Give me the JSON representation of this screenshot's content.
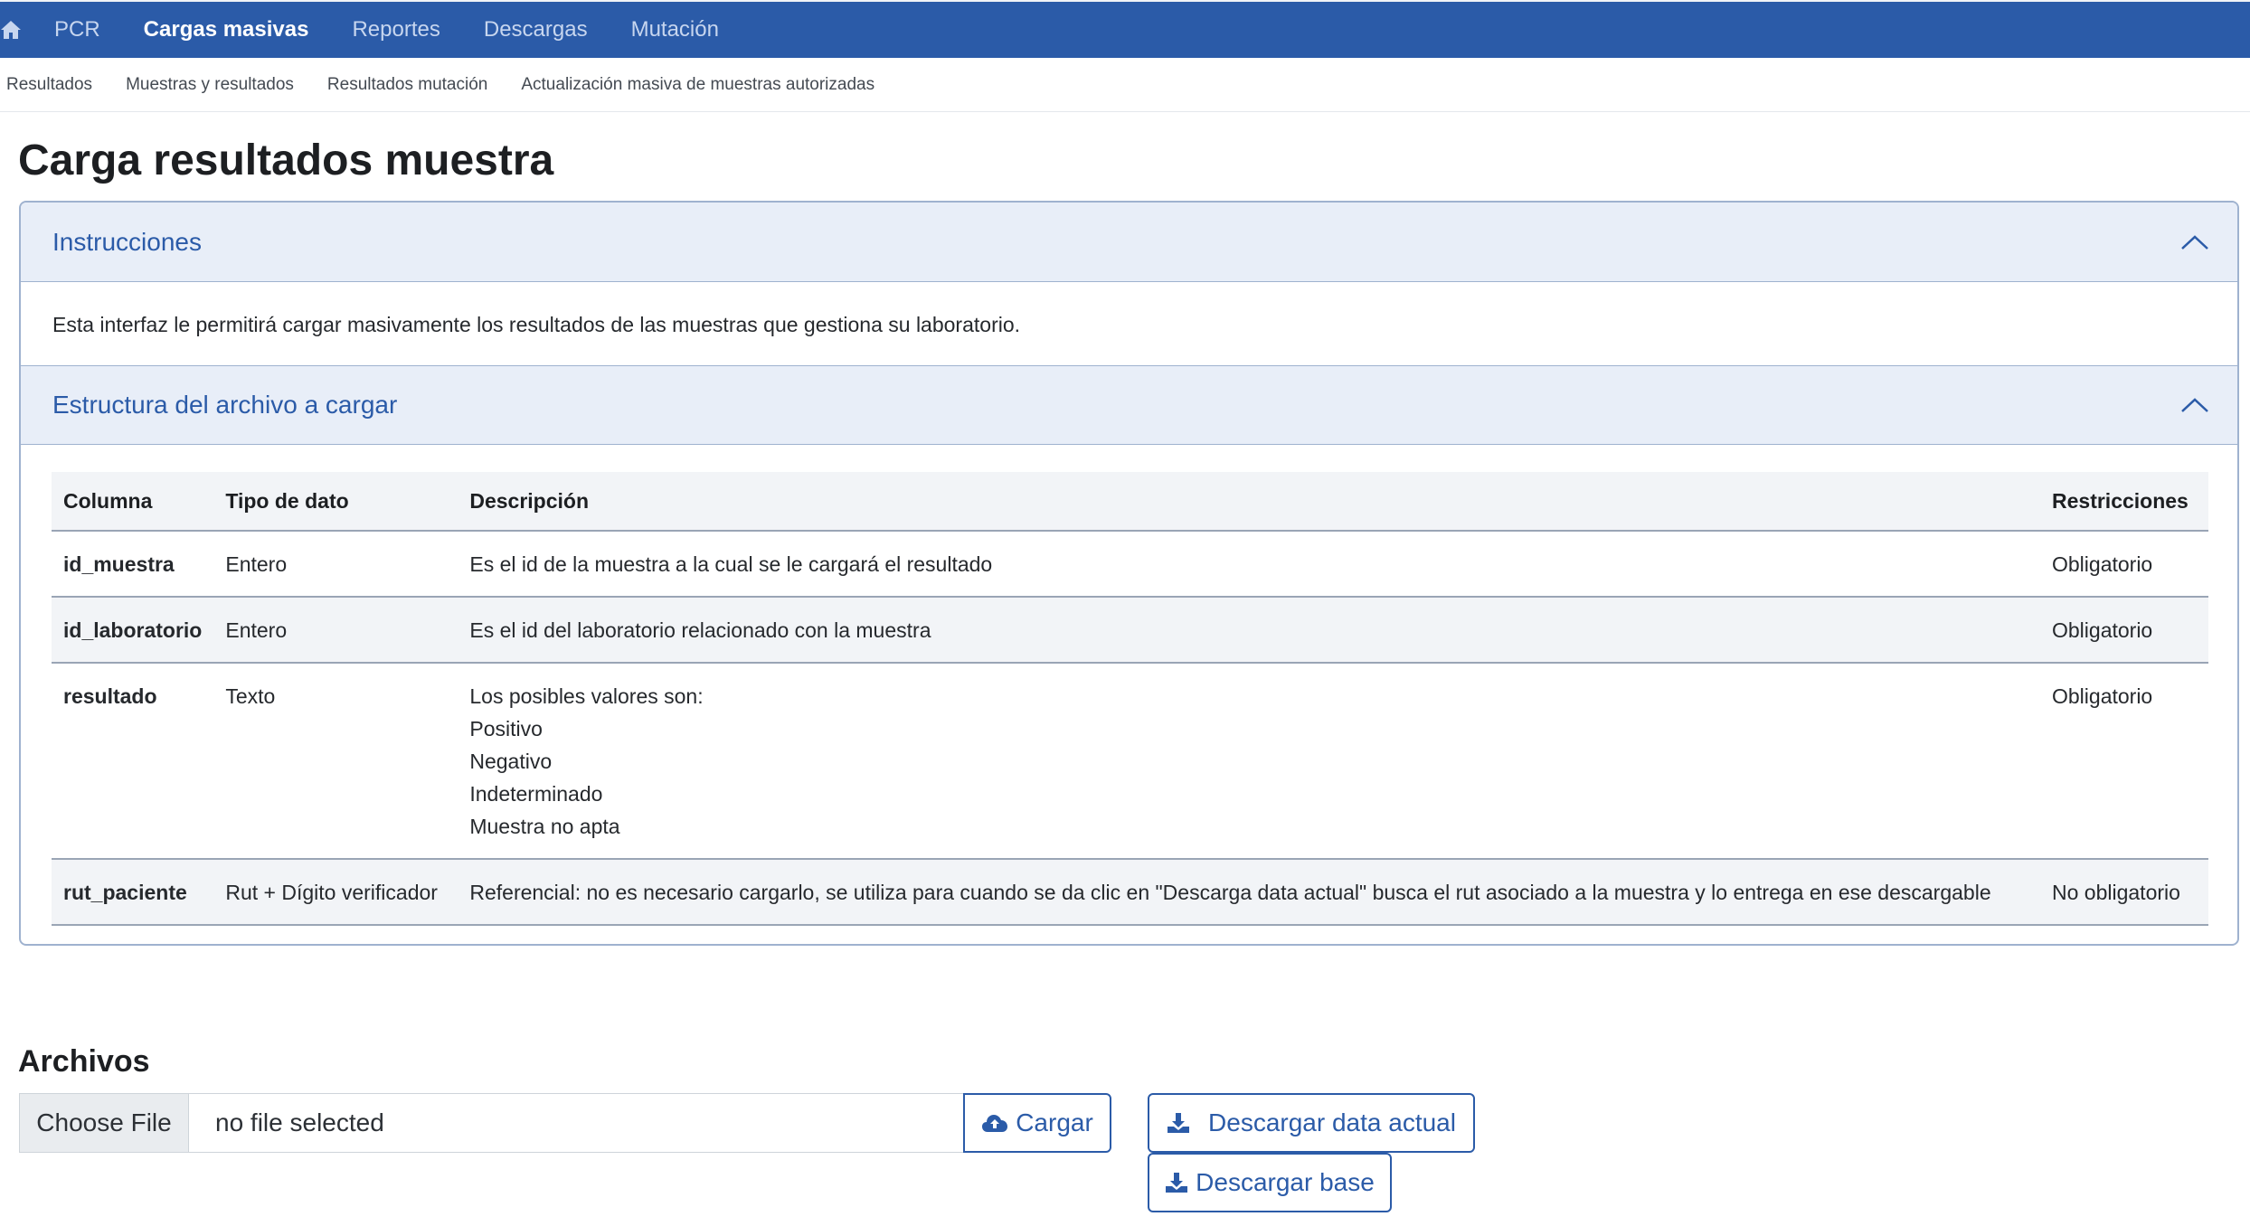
{
  "topnav": {
    "items": [
      {
        "label": "PCR",
        "active": false
      },
      {
        "label": "Cargas masivas",
        "active": true
      },
      {
        "label": "Reportes",
        "active": false
      },
      {
        "label": "Descargas",
        "active": false
      },
      {
        "label": "Mutación",
        "active": false
      }
    ]
  },
  "subnav": {
    "items": [
      "Resultados",
      "Muestras y resultados",
      "Resultados mutación",
      "Actualización masiva de muestras autorizadas"
    ]
  },
  "page": {
    "title": "Carga resultados muestra"
  },
  "instructions": {
    "title": "Instrucciones",
    "text": "Esta interfaz le permitirá cargar masivamente los resultados de las muestras que gestiona su laboratorio."
  },
  "structure": {
    "title": "Estructura del archivo a cargar",
    "headers": [
      "Columna",
      "Tipo de dato",
      "Descripción",
      "Restricciones"
    ],
    "rows": [
      {
        "column": "id_muestra",
        "type": "Entero",
        "description": [
          "Es el id de la muestra a la cual se le cargará el resultado"
        ],
        "restriction": "Obligatorio"
      },
      {
        "column": "id_laboratorio",
        "type": "Entero",
        "description": [
          "Es el id del laboratorio relacionado con la muestra"
        ],
        "restriction": "Obligatorio"
      },
      {
        "column": "resultado",
        "type": "Texto",
        "description": [
          "Los posibles valores son:",
          "Positivo",
          "Negativo",
          "Indeterminado",
          "Muestra no apta"
        ],
        "restriction": "Obligatorio"
      },
      {
        "column": "rut_paciente",
        "type": "Rut + Dígito verificador",
        "description": [
          "Referencial: no es necesario cargarlo, se utiliza para cuando se da clic en \"Descarga data actual\" busca el rut asociado a la muestra y lo entrega en ese descargable"
        ],
        "restriction": "No obligatorio"
      }
    ]
  },
  "files": {
    "title": "Archivos",
    "choose_label": "Choose File",
    "file_status": "no file selected",
    "upload_label": "Cargar",
    "download_current_label": "Descargar data actual",
    "download_base_label": "Descargar base"
  },
  "icons": {
    "home": "home-icon",
    "chevron": "chevron-up-icon",
    "upload": "cloud-upload-icon",
    "download": "download-icon"
  },
  "colors": {
    "brand": "#2b5ba8",
    "accordion_bg": "#e8eef8"
  }
}
